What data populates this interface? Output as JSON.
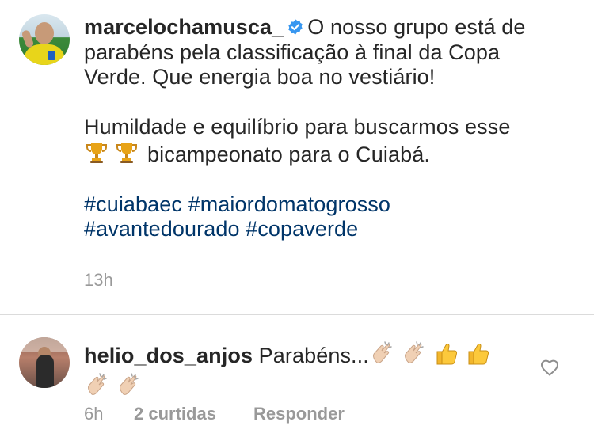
{
  "post": {
    "username": "marcelochamusca_",
    "caption_line_1": "O nosso grupo está de",
    "caption_line_2": "parabéns pela classificação à final da Copa",
    "caption_line_3": "Verde. Que energia boa no vestiário!",
    "caption_line_4": "Humildade e equilíbrio para buscarmos esse",
    "caption_line_5": "bicampeonato para o Cuiabá.",
    "hashtags_line_1": "#cuiabaec #maiordomatogrosso",
    "hashtags_line_2": "#avantedourado #copaverde",
    "timestamp": "13h",
    "verified": true,
    "caption_emoji": [
      "trophy-icon",
      "trophy-icon"
    ]
  },
  "reply": {
    "username": "helio_dos_anjos",
    "text": "Parabéns...",
    "emoji": [
      "clapping-hands-icon",
      "clapping-hands-icon",
      "thumbs-up-icon",
      "thumbs-up-icon",
      "clapping-hands-icon",
      "clapping-hands-icon"
    ],
    "timestamp": "6h",
    "likes": "2 curtidas",
    "reply_action": "Responder",
    "like_icon": "heart-outline-icon"
  },
  "colors": {
    "text": "#262626",
    "hashtag": "#003569",
    "meta": "#999999",
    "verified": "#3897f0",
    "divider": "#dbdbdb"
  }
}
